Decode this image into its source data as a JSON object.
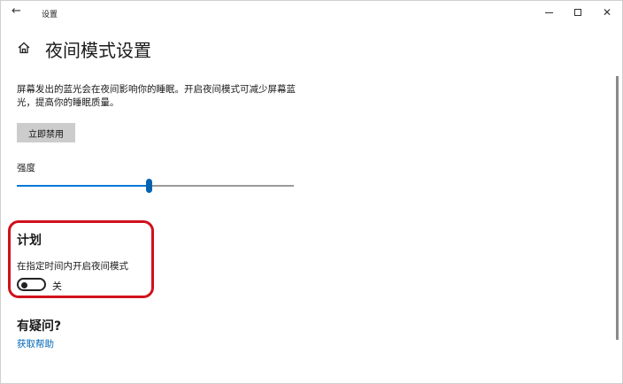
{
  "window": {
    "app_title": "设置",
    "back_icon": "arrow-left-icon",
    "minimize_icon": "minimize-icon",
    "maximize_icon": "maximize-icon",
    "close_icon": "close-icon"
  },
  "header": {
    "home_icon": "home-icon",
    "title": "夜间模式设置"
  },
  "description": "屏幕发出的蓝光会在夜间影响你的睡眠。开启夜间模式可减少屏幕蓝光，提高你的睡眠质量。",
  "disable_button_label": "立即禁用",
  "strength": {
    "label": "强度",
    "value_fraction": 0.48
  },
  "schedule": {
    "title": "计划",
    "description": "在指定时间内开启夜间模式",
    "toggle_on": false,
    "toggle_state_label": "关"
  },
  "faq": {
    "title": "有疑问?",
    "help_link": "获取帮助"
  },
  "colors": {
    "accent": "#0078d7",
    "highlight_border": "#d0111b",
    "button_bg": "#cccccc",
    "link": "#0067b8"
  }
}
